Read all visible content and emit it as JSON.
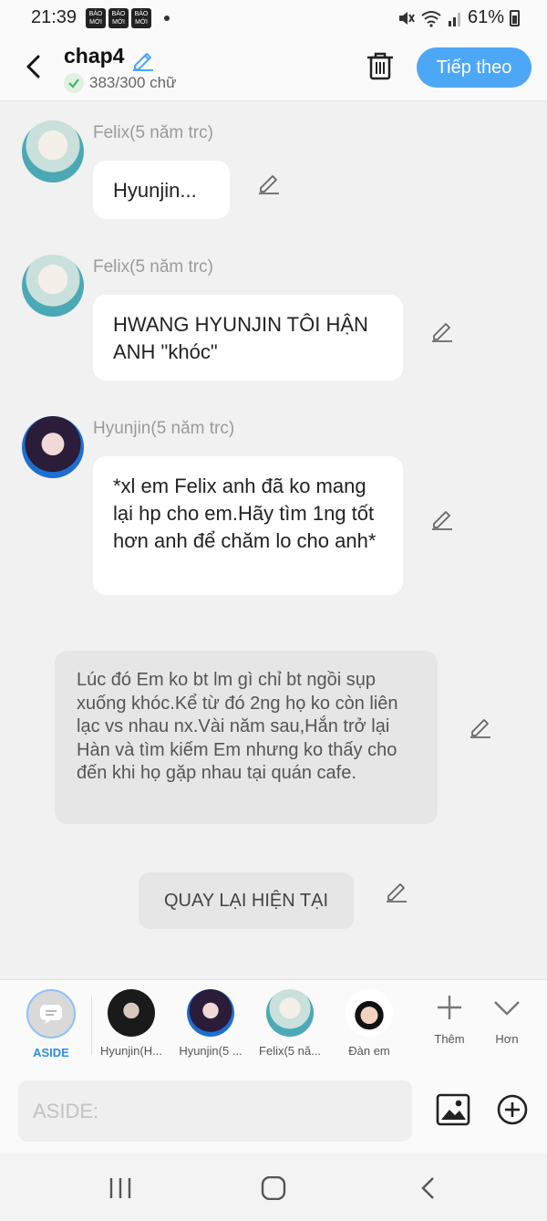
{
  "status_bar": {
    "time": "21:39",
    "badges": [
      "BÁO MỚI",
      "BÁO MỚI",
      "BÁO MỚI"
    ],
    "battery": "61%"
  },
  "header": {
    "title": "chap4",
    "word_count": "383/300 chữ",
    "next_label": "Tiếp theo"
  },
  "messages": [
    {
      "speaker": "Felix(5 năm trc)",
      "text": "Hyunjin..."
    },
    {
      "speaker": "Felix(5 năm trc)",
      "text": "HWANG HYUNJIN TÔI HẬN ANH \"khóc\""
    },
    {
      "speaker": "Hyunjin(5 năm trc)",
      "text": "*xl em Felix anh đã ko mang lại hp cho em.Hãy tìm 1ng tốt hơn anh để chăm lo cho anh*"
    }
  ],
  "aside_text": "Lúc đó Em ko bt lm gì chỉ bt ngồi sụp xuống khóc.Kể từ đó 2ng họ ko còn liên lạc vs nhau nx.Vài năm sau,Hắn trở lại Hàn và tìm kiếm Em nhưng ko thấy cho đến khi họ gặp nhau tại quán cafe.",
  "return_label": "QUAY LẠI HIỆN TẠI",
  "characters": [
    {
      "label": "ASIDE"
    },
    {
      "label": "Hyunjin(H..."
    },
    {
      "label": "Hyunjin(5 ..."
    },
    {
      "label": "Felix(5 nă..."
    },
    {
      "label": "Đàn em"
    }
  ],
  "tools": {
    "more_label": "Thêm",
    "expand_label": "Hơn"
  },
  "input": {
    "placeholder": "ASIDE:"
  },
  "colors": {
    "accent": "#4da7f7",
    "aside_selected": "#2f8de4",
    "background": "#f1f1f1"
  }
}
